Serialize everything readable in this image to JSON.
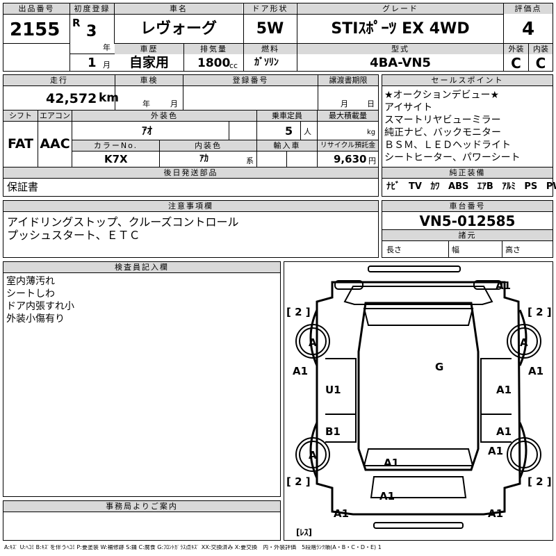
{
  "header": {
    "lot_label": "出品番号",
    "lot_no": "2155",
    "first_reg_label": "初度登録",
    "era": "R",
    "year": "3",
    "year_unit": "年",
    "month": "1",
    "month_unit": "月",
    "car_name_label": "車名",
    "car_name": "レヴォーグ",
    "door_label": "ドア形状",
    "door": "5W",
    "grade_label": "グレード",
    "grade": "STIｽﾎﾟｰﾂ EX 4WD",
    "score_label": "評価点",
    "score": "4",
    "history_label": "車歴",
    "history": "自家用",
    "displacement_label": "排気量",
    "displacement": "1800",
    "displacement_unit": "cc",
    "fuel_label": "燃料",
    "fuel": "ｶﾞｿﾘﾝ",
    "model_label": "型式",
    "model": "4BA-VN5",
    "exterior_label": "外装",
    "exterior": "C",
    "interior_label": "内装",
    "interior": "C"
  },
  "specs": {
    "mileage_label": "走行",
    "mileage": "42,572",
    "mileage_unit": "km",
    "inspection_label": "車検",
    "insp_year_unit": "年",
    "insp_month_unit": "月",
    "reg_no_label": "登録番号",
    "transfer_label": "譲渡書期限",
    "transfer_month_unit": "月",
    "transfer_day_unit": "日",
    "shift_label": "シフト",
    "shift": "FAT",
    "ac_label": "エアコン",
    "ac": "AAC",
    "ext_color_label": "外装色",
    "ext_color": "ｱｵ",
    "capacity_label": "乗車定員",
    "capacity": "5",
    "capacity_unit": "人",
    "max_load_label": "最大積載量",
    "max_load_unit": "kg",
    "color_no_label": "カラーNo.",
    "color_no": "K7X",
    "int_color_label": "内装色",
    "int_color": "ｱｶ",
    "int_color_unit": "系",
    "import_label": "輸入車",
    "recycle_label": "リサイクル預託金",
    "recycle": "9,630",
    "recycle_unit": "円"
  },
  "later_parts": {
    "label": "後日発送部品",
    "value": "保証書"
  },
  "sales_points": {
    "label": "セールスポイント",
    "items": [
      "★オークションデビュー★",
      "アイサイト",
      "スマートリヤビューミラー",
      "純正ナビ、バックモニター",
      "ＢＳＭ、ＬＥＤヘッドライト",
      "シートヒーター、パワーシート"
    ]
  },
  "equipment": {
    "label": "純正装備",
    "items": [
      "ﾅﾋﾞ",
      "TV",
      "ｶﾜ",
      "ABS",
      "ｴｱB",
      "ｱﾙﾐ",
      "PS",
      "PW"
    ]
  },
  "notes": {
    "label": "注意事項欄",
    "lines": [
      "アイドリングストップ、クルーズコントロール",
      "プッシュスタート、ＥＴＣ"
    ]
  },
  "chassis": {
    "label": "車台番号",
    "value": "VN5-012585",
    "spec_label": "諸元",
    "length_label": "長さ",
    "width_label": "幅",
    "height_label": "高さ"
  },
  "inspector": {
    "label": "検査員記入欄",
    "lines": [
      "室内薄汚れ",
      "シートしわ",
      "ドア内張すれ小",
      "外装小傷有り"
    ]
  },
  "office": {
    "label": "事務局よりご案内"
  },
  "diagram": {
    "marks": [
      "A1",
      "[ 2 ]",
      "[ 2 ]",
      "A",
      "A",
      "A1",
      "A1",
      "U1",
      "A1",
      "G",
      "B1",
      "A1",
      "A1",
      "A",
      "A1",
      "[ 2 ]",
      "[ 2 ]",
      "A1",
      "A1",
      "A1",
      "[ﾚｽ]"
    ]
  },
  "legend": "A:ｷｽﾞ U:ﾍｺﾐ B:ｷｽﾞを伴うﾍｺﾐ P:要塗装 W:補修跡 S:錆 C:腐食 G:ﾌﾛﾝﾄｶﾞﾗｽ点ｷｽﾞ XX:交換済み X:要交換　内・外装評価　5段階ﾗﾝｸ順(A・B・C・D・E) 1"
}
